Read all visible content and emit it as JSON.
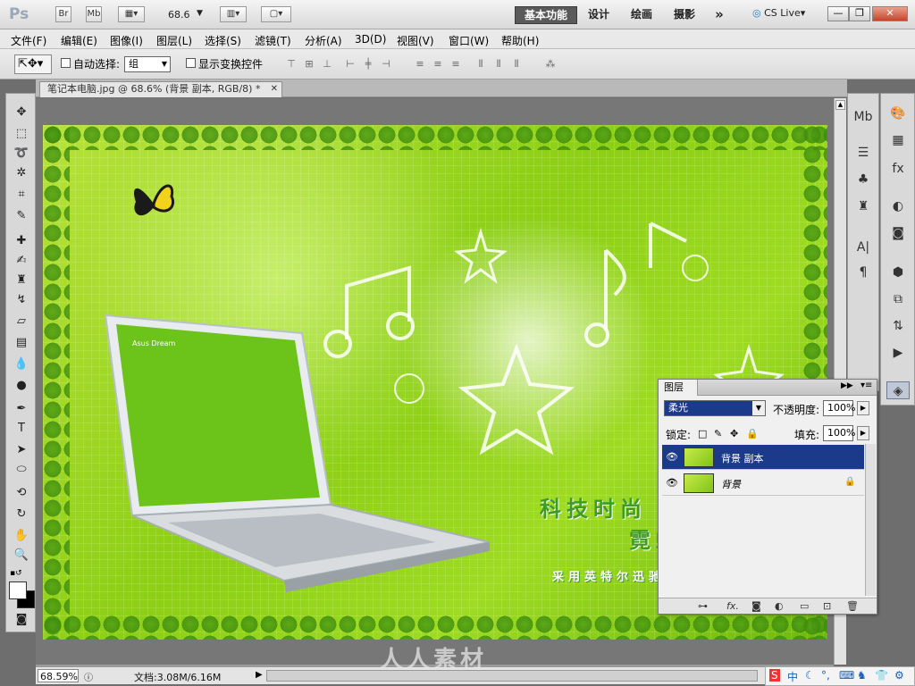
{
  "app": {
    "logo": "Ps",
    "bridge_btn": "Br",
    "minibridge_btn": "Mb",
    "zoom_value": "68.6",
    "workspaces": [
      "基本功能",
      "设计",
      "绘画",
      "摄影"
    ],
    "more": "»",
    "cslive": "CS Live",
    "window_buttons": [
      "—",
      "❐",
      "✕"
    ]
  },
  "menu": [
    "文件(F)",
    "编辑(E)",
    "图像(I)",
    "图层(L)",
    "选择(S)",
    "滤镜(T)",
    "分析(A)",
    "3D(D)",
    "视图(V)",
    "窗口(W)",
    "帮助(H)"
  ],
  "options": {
    "auto_select_label": "自动选择:",
    "auto_select_value": "组",
    "show_transform_label": "显示变换控件"
  },
  "document": {
    "tab_title": "笔记本电脑.jpg @ 68.6% (背景 副本, RGB/8) *",
    "close": "✕"
  },
  "artwork": {
    "title_line1": "科技时尚",
    "title_line2": "霓虹",
    "subtitle": "采用英特尔迅驰",
    "screen_text": "Asus Dream"
  },
  "status": {
    "zoom": "68.59%",
    "doc_size": "文档:3.08M/6.16M"
  },
  "layers_panel": {
    "tab": "图层",
    "blend_mode": "柔光",
    "opacity_label": "不透明度:",
    "opacity_value": "100%",
    "lock_label": "锁定:",
    "fill_label": "填充:",
    "fill_value": "100%",
    "layers": [
      {
        "name": "背景 副本",
        "selected": true,
        "locked": false
      },
      {
        "name": "背景",
        "selected": false,
        "locked": true
      }
    ],
    "footer_icons": [
      "link-icon",
      "fx-icon",
      "mask-icon",
      "adjustment-icon",
      "group-icon",
      "new-layer-icon",
      "trash-icon"
    ]
  },
  "ime": {
    "items": [
      "S",
      "中",
      "☾",
      "°,",
      "⌨",
      "♞",
      "👕",
      "⚙"
    ]
  },
  "watermark": "人人素材"
}
